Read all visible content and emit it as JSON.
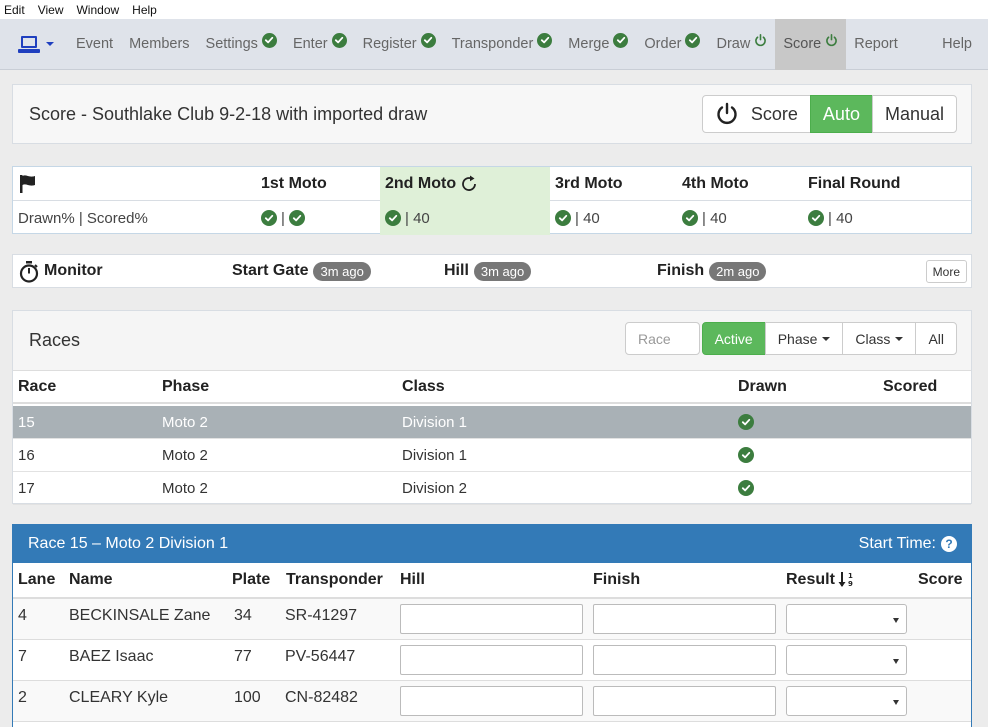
{
  "menubar": [
    "Edit",
    "View",
    "Window",
    "Help"
  ],
  "nav": {
    "items": [
      {
        "label": "Event",
        "status": "none"
      },
      {
        "label": "Members",
        "status": "none"
      },
      {
        "label": "Settings",
        "status": "check"
      },
      {
        "label": "Enter",
        "status": "check"
      },
      {
        "label": "Register",
        "status": "check"
      },
      {
        "label": "Transponder",
        "status": "check"
      },
      {
        "label": "Merge",
        "status": "check"
      },
      {
        "label": "Order",
        "status": "check"
      },
      {
        "label": "Draw",
        "status": "power"
      },
      {
        "label": "Score",
        "status": "power",
        "active": true
      },
      {
        "label": "Report",
        "status": "none"
      }
    ],
    "help": "Help"
  },
  "title": "Score - Southlake Club 9-2-18 with imported draw",
  "score_buttons": {
    "score": "Score",
    "auto": "Auto",
    "manual": "Manual"
  },
  "motos": {
    "row_label": "Drawn% | Scored%",
    "columns": [
      {
        "name": "1st Moto",
        "drawn": "check",
        "scored": "check",
        "value": ""
      },
      {
        "name": "2nd Moto",
        "drawn": "check",
        "scored": "",
        "value": "| 40",
        "current": true
      },
      {
        "name": "3rd Moto",
        "drawn": "check",
        "scored": "",
        "value": "| 40"
      },
      {
        "name": "4th Moto",
        "drawn": "check",
        "scored": "",
        "value": "| 40"
      },
      {
        "name": "Final Round",
        "drawn": "check",
        "scored": "",
        "value": "| 40"
      }
    ]
  },
  "monitor": {
    "label": "Monitor",
    "start_gate": {
      "label": "Start Gate",
      "badge": "3m ago"
    },
    "hill": {
      "label": "Hill",
      "badge": "3m ago"
    },
    "finish": {
      "label": "Finish",
      "badge": "2m ago"
    },
    "more": "More"
  },
  "races": {
    "title": "Races",
    "race_placeholder": "Race",
    "filters": {
      "active": "Active",
      "phase": "Phase",
      "class": "Class",
      "all": "All"
    },
    "headers": {
      "race": "Race",
      "phase": "Phase",
      "class": "Class",
      "drawn": "Drawn",
      "scored": "Scored"
    },
    "rows": [
      {
        "race": "15",
        "phase": "Moto 2",
        "class": "Division 1",
        "drawn": "check",
        "selected": true
      },
      {
        "race": "16",
        "phase": "Moto 2",
        "class": "Division 1",
        "drawn": "check"
      },
      {
        "race": "17",
        "phase": "Moto 2",
        "class": "Division 2",
        "drawn": "check"
      }
    ]
  },
  "race_detail": {
    "title": "Race 15 – Moto 2 Division 1",
    "start_time": "Start Time:",
    "headers": {
      "lane": "Lane",
      "name": "Name",
      "plate": "Plate",
      "transponder": "Transponder",
      "hill": "Hill",
      "finish": "Finish",
      "result": "Result",
      "score": "Score"
    },
    "rows": [
      {
        "lane": "4",
        "name": "BECKINSALE Zane",
        "plate": "34",
        "transponder": "SR-41297"
      },
      {
        "lane": "7",
        "name": "BAEZ Isaac",
        "plate": "77",
        "transponder": "PV-56447"
      },
      {
        "lane": "2",
        "name": "CLEARY Kyle",
        "plate": "100",
        "transponder": "CN-82482"
      }
    ]
  },
  "colors": {
    "check_green": "#3c7d3f",
    "accent_green": "#5cb85c",
    "primary_blue": "#337ab7",
    "selected_row": "#a9b1b6",
    "moto_highlight": "#dff0d8"
  }
}
